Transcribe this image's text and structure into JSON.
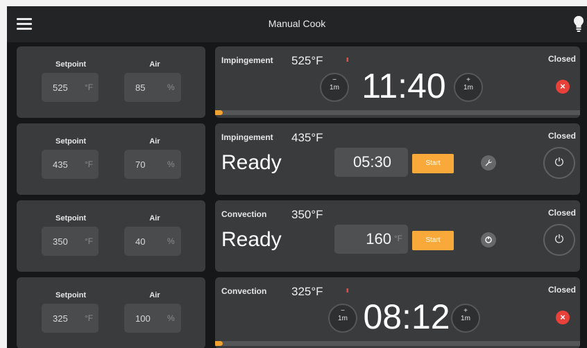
{
  "header": {
    "title": "Manual Cook",
    "menu_icon": "menu-icon",
    "light_icon": "lightbulb-icon"
  },
  "rows": [
    {
      "left": {
        "setpoint_label": "Setpoint",
        "setpoint_value": "525",
        "setpoint_unit": "°F",
        "air_label": "Air",
        "air_value": "85",
        "air_unit": "%"
      },
      "right": {
        "mode": "Impingement",
        "temp": "525°F",
        "paused_mark": "II",
        "status": "Closed",
        "timer": "11:40",
        "minus_label": "1m",
        "plus_label": "1m",
        "progress": 0.01,
        "cancel_glyph": "×"
      }
    },
    {
      "left": {
        "setpoint_label": "Setpoint",
        "setpoint_value": "435",
        "setpoint_unit": "°F",
        "air_label": "Air",
        "air_value": "70",
        "air_unit": "%"
      },
      "right": {
        "mode": "Impingement",
        "temp": "435°F",
        "status": "Closed",
        "state": "Ready",
        "time_value": "05:30",
        "time_unit": "",
        "start_label": "Start",
        "tool_icon": "wrench-icon",
        "power_icon": "power-icon"
      }
    },
    {
      "left": {
        "setpoint_label": "Setpoint",
        "setpoint_value": "350",
        "setpoint_unit": "°F",
        "air_label": "Air",
        "air_value": "40",
        "air_unit": "%"
      },
      "right": {
        "mode": "Convection",
        "temp": "350°F",
        "status": "Closed",
        "state": "Ready",
        "time_value": "160",
        "time_unit": "°F",
        "start_label": "Start",
        "tool_icon": "probe-icon",
        "power_icon": "power-icon"
      }
    },
    {
      "left": {
        "setpoint_label": "Setpoint",
        "setpoint_value": "325",
        "setpoint_unit": "°F",
        "air_label": "Air",
        "air_value": "100",
        "air_unit": "%"
      },
      "right": {
        "mode": "Convection",
        "temp": "325°F",
        "paused_mark": "II",
        "status": "Closed",
        "timer": "08:12",
        "minus_label": "1m",
        "plus_label": "1m",
        "progress": 0.005,
        "cancel_glyph": "×"
      }
    }
  ],
  "colors": {
    "accent": "#f9a83a",
    "cancel": "#e8413a",
    "panel": "#3a3b3d",
    "background": "#151719"
  }
}
